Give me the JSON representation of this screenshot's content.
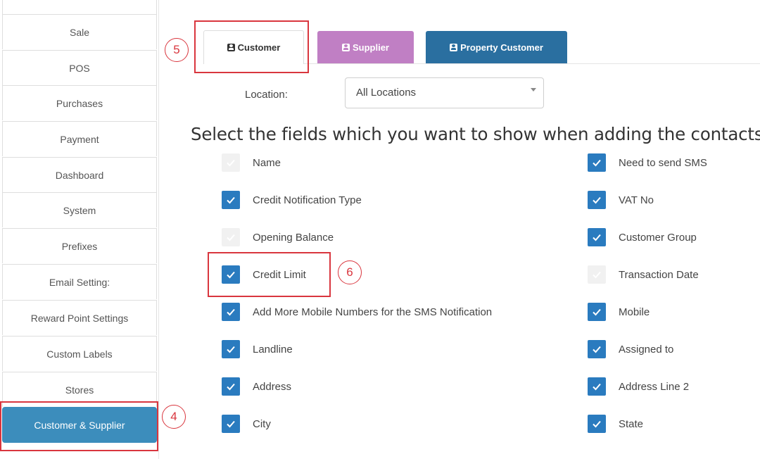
{
  "sidebar": {
    "items": [
      {
        "label": "Sale"
      },
      {
        "label": "POS"
      },
      {
        "label": "Purchases"
      },
      {
        "label": "Payment"
      },
      {
        "label": "Dashboard"
      },
      {
        "label": "System"
      },
      {
        "label": "Prefixes"
      },
      {
        "label": "Email Setting:"
      },
      {
        "label": "Reward Point Settings"
      },
      {
        "label": "Custom Labels"
      },
      {
        "label": "Stores"
      },
      {
        "label": "Customer & Supplier",
        "active": true
      }
    ]
  },
  "tabs": [
    {
      "label": "Customer",
      "icon": "contact-card-icon",
      "active": true
    },
    {
      "label": "Supplier",
      "icon": "contact-card-icon",
      "color": "#c07fc4"
    },
    {
      "label": "Property Customer",
      "icon": "contact-card-icon",
      "color": "#2a6fa0"
    }
  ],
  "location": {
    "label": "Location:",
    "selected": "All Locations"
  },
  "heading": "Select the fields which you want to show when adding the contacts",
  "fields_left": [
    {
      "label": "Name",
      "checked": true,
      "disabled": true
    },
    {
      "label": "Credit Notification Type",
      "checked": true
    },
    {
      "label": "Opening Balance",
      "checked": true,
      "disabled": true
    },
    {
      "label": "Credit Limit",
      "checked": true
    },
    {
      "label": "Add More Mobile Numbers for the SMS Notification",
      "checked": true
    },
    {
      "label": "Landline",
      "checked": true
    },
    {
      "label": "Address",
      "checked": true
    },
    {
      "label": "City",
      "checked": true
    }
  ],
  "fields_right": [
    {
      "label": "Need to send SMS",
      "checked": true
    },
    {
      "label": "VAT No",
      "checked": true
    },
    {
      "label": "Customer Group",
      "checked": true
    },
    {
      "label": "Transaction Date",
      "checked": true,
      "disabled": true
    },
    {
      "label": "Mobile",
      "checked": true
    },
    {
      "label": "Assigned to",
      "checked": true
    },
    {
      "label": "Address Line 2",
      "checked": true
    },
    {
      "label": "State",
      "checked": true
    }
  ],
  "annotations": [
    "4",
    "5",
    "6"
  ],
  "colors": {
    "accent": "#3c8dbc",
    "checkbox": "#2a7bbf",
    "annotation": "#d9363e"
  }
}
